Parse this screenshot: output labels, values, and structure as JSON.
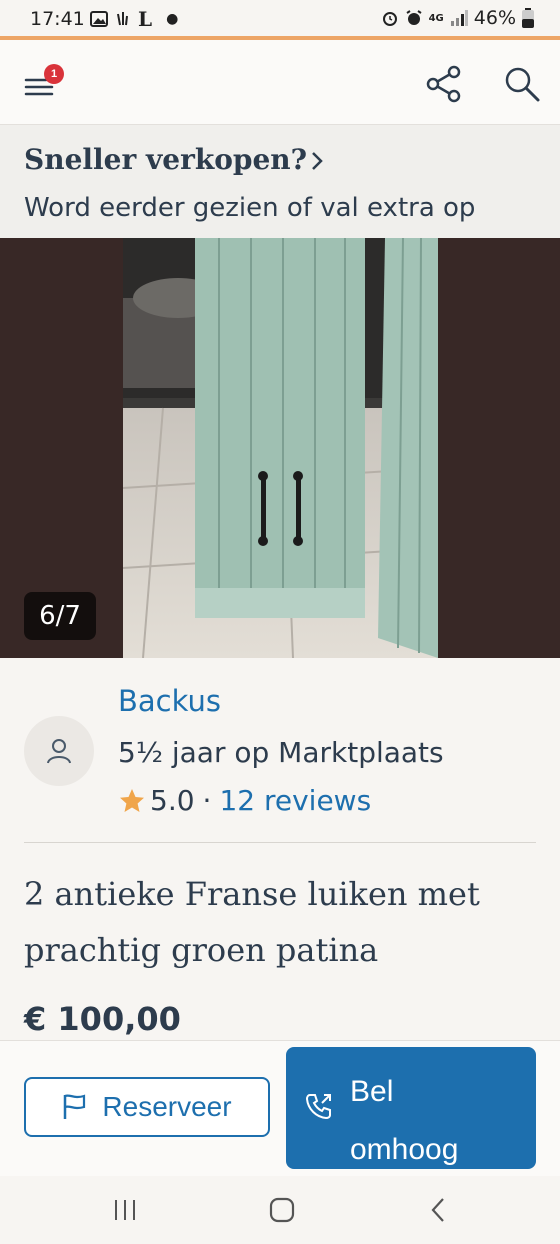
{
  "status_bar": {
    "time": "17:41",
    "network": "4G",
    "battery": "46%",
    "icons": [
      "image-icon",
      "notification-icon",
      "l-app-icon",
      "dot-icon",
      "alarm-icon",
      "signal-icon",
      "battery-icon"
    ]
  },
  "header": {
    "menu_badge": "1",
    "icons": [
      "menu-icon",
      "share-icon",
      "search-icon"
    ]
  },
  "promo": {
    "title": "Sneller verkopen?",
    "subtitle": "Word eerder gezien of val extra op"
  },
  "gallery": {
    "counter": "6/7"
  },
  "seller": {
    "name": "Backus",
    "years": "5½ jaar op Marktplaats",
    "rating": "5.0",
    "separator": "·",
    "reviews": "12 reviews"
  },
  "listing": {
    "title": "2 antieke Franse luiken met prachtig groen patina",
    "price": "€ 100,00"
  },
  "actions": {
    "reserve_label": "Reserveer",
    "call_label": "Bel omhoog"
  },
  "colors": {
    "accent_line": "#eda566",
    "link_blue": "#1d6fae",
    "text_dark": "#2d3c4d",
    "badge_red": "#d9333a",
    "star": "#f0a54a"
  }
}
